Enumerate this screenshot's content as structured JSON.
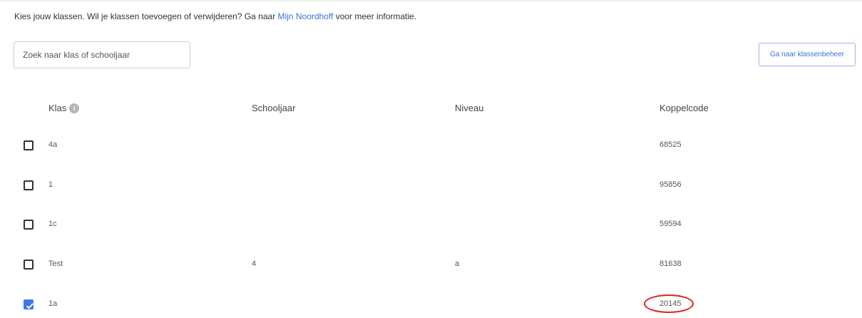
{
  "intro": {
    "text_before": "Kies jouw klassen. Wil je klassen toevoegen of verwijderen? Ga naar ",
    "link": "Mijn Noordhoff",
    "text_after": " voor meer informatie."
  },
  "search": {
    "placeholder": "Zoek naar klas of schooljaar",
    "value": ""
  },
  "manage_button": "Ga naar klassenbeheer",
  "table": {
    "headers": {
      "klas": "Klas",
      "klas_badge": "i",
      "schooljaar": "Schooljaar",
      "niveau": "Niveau",
      "koppelcode": "Koppelcode"
    },
    "rows": [
      {
        "klas": "4a",
        "schooljaar": "",
        "niveau": "",
        "koppelcode": "68525",
        "checked": false
      },
      {
        "klas": "1",
        "schooljaar": "",
        "niveau": "",
        "koppelcode": "95856",
        "checked": false
      },
      {
        "klas": "1c",
        "schooljaar": "",
        "niveau": "",
        "koppelcode": "59594",
        "checked": false
      },
      {
        "klas": "Test",
        "schooljaar": "4",
        "niveau": "a",
        "koppelcode": "81638",
        "checked": false
      },
      {
        "klas": "1a",
        "schooljaar": "",
        "niveau": "",
        "koppelcode": "20145",
        "checked": true
      }
    ]
  },
  "colors": {
    "accent": "#3d78e6",
    "link": "#3d6fe0",
    "annotation": "#e0201c"
  }
}
